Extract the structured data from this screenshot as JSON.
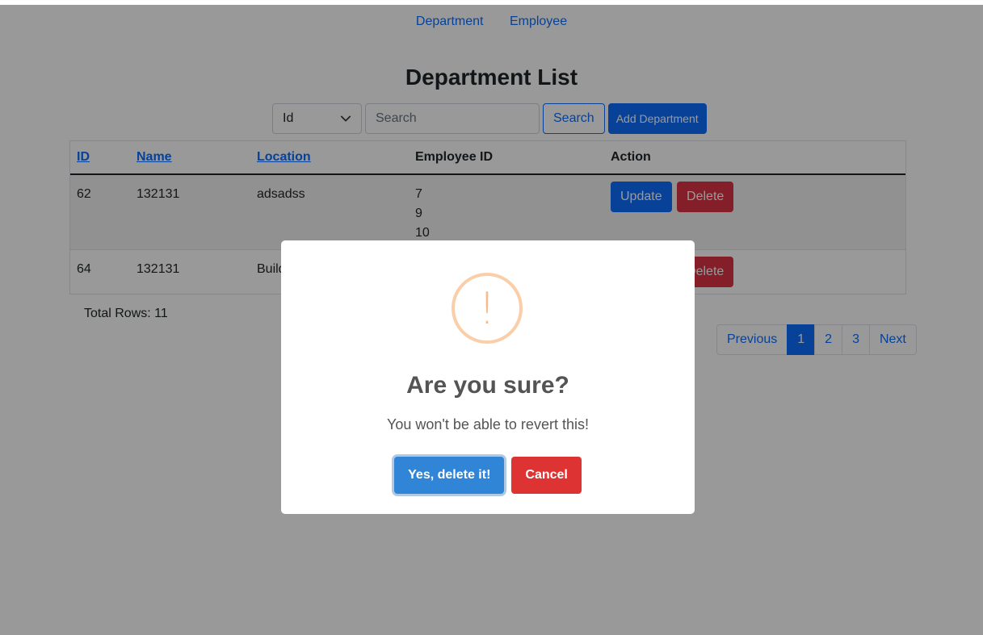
{
  "nav": {
    "items": [
      "Department",
      "Employee"
    ]
  },
  "page": {
    "title": "Department List"
  },
  "toolbar": {
    "select_value": "Id",
    "search_placeholder": "Search",
    "search_button": "Search",
    "add_button": "Add Department"
  },
  "table": {
    "headers": {
      "id": "ID",
      "name": "Name",
      "location": "Location",
      "employee_id": "Employee ID",
      "action": "Action"
    },
    "rows": [
      {
        "id": "62",
        "name": "132131",
        "location": "adsadss",
        "employee_ids": [
          "7",
          "9",
          "10"
        ]
      },
      {
        "id": "64",
        "name": "132131",
        "location": "Build",
        "employee_ids": []
      }
    ],
    "update_label": "Update",
    "delete_label": "Delete"
  },
  "total_rows": "Total Rows: 11",
  "pagination": {
    "previous": "Previous",
    "pages": [
      "1",
      "2",
      "3"
    ],
    "next": "Next",
    "active_page": "1"
  },
  "modal": {
    "icon_glyph": "!",
    "title": "Are you sure?",
    "text": "You won't be able to revert this!",
    "confirm_label": "Yes, delete it!",
    "cancel_label": "Cancel"
  },
  "colors": {
    "primary": "#0d6efd",
    "danger": "#dc3545",
    "confirm": "#3085d6",
    "cancel": "#dd3333",
    "warning_icon": "#f8bb86"
  }
}
